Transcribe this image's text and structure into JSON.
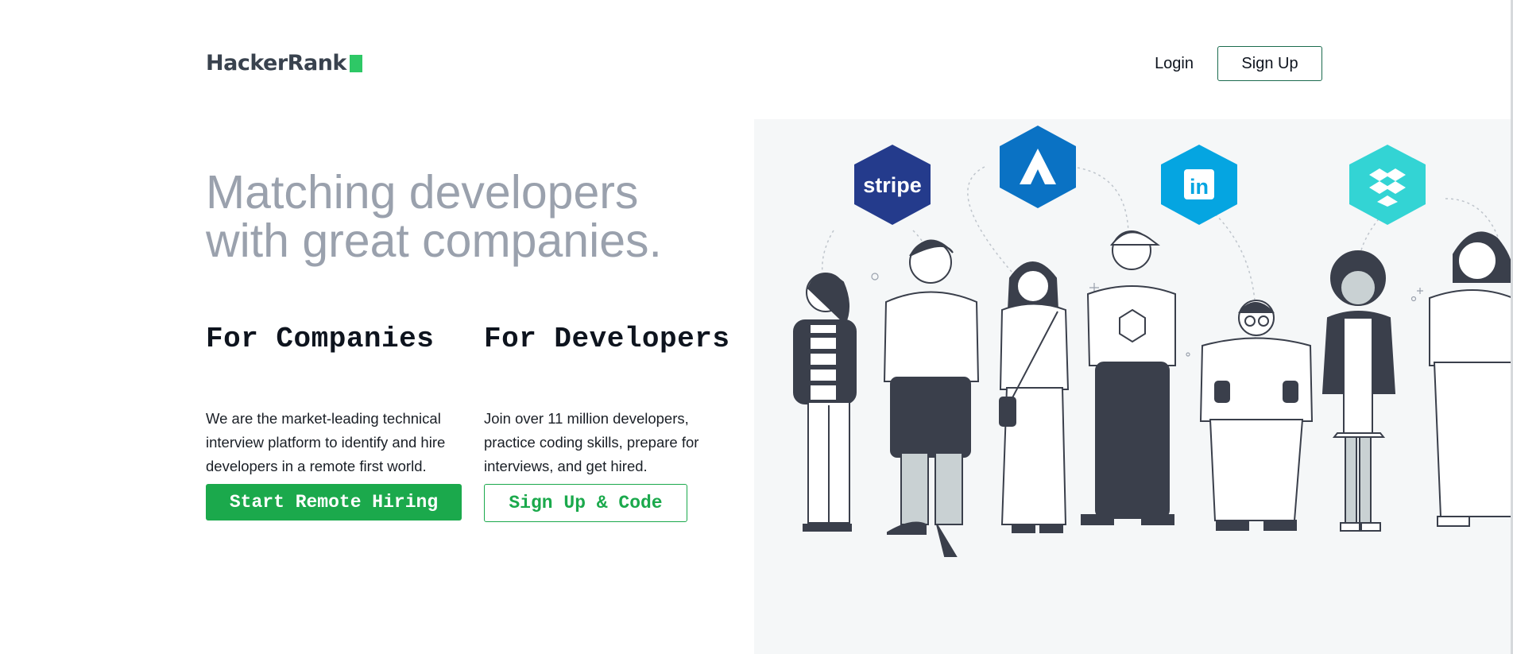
{
  "header": {
    "logo_text": "HackerRank",
    "login_label": "Login",
    "signup_label": "Sign Up"
  },
  "hero": {
    "headline_line1": "Matching developers",
    "headline_line2": "with great companies."
  },
  "companies": {
    "title": "For Companies",
    "description": "We are the market-leading technical interview platform to identify and hire developers in a remote first world.",
    "button_label": "Start Remote Hiring"
  },
  "developers": {
    "title": "For Developers",
    "description": "Join over 11 million developers, practice coding skills, prepare for interviews, and get hired.",
    "button_label": "Sign Up & Code"
  },
  "illustration": {
    "brand_badges": [
      {
        "name": "stripe",
        "label": "stripe",
        "color": "#243b8c"
      },
      {
        "name": "atlassian",
        "label": "",
        "color": "#0a72c4"
      },
      {
        "name": "linkedin",
        "label": "in",
        "color": "#05a5e1"
      },
      {
        "name": "dropbox",
        "label": "",
        "color": "#33d4d4"
      }
    ]
  },
  "colors": {
    "brand_green": "#1ba94c",
    "logo_green": "#2ec866",
    "heading_gray": "#9aa1ad",
    "dark_ink": "#39424e"
  }
}
